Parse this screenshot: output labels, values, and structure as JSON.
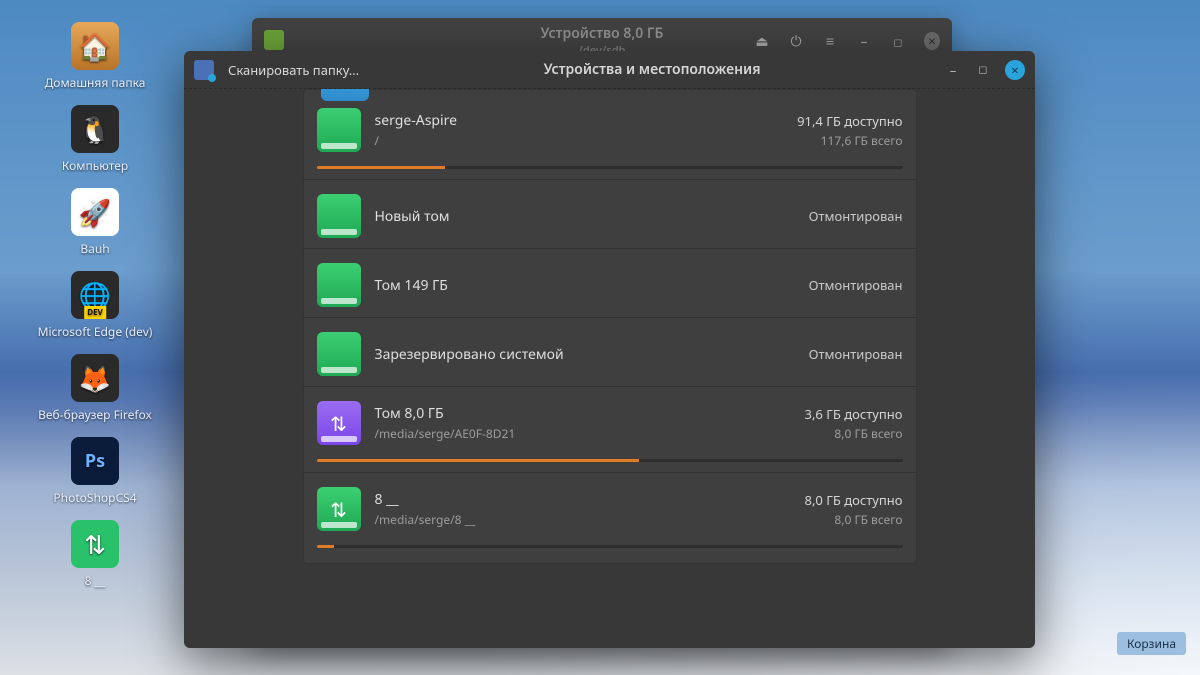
{
  "desktop": {
    "icons": [
      {
        "label": "Домашняя папка",
        "glyph": "house"
      },
      {
        "label": "Компьютер",
        "glyph": "tux"
      },
      {
        "label": "Bauh",
        "glyph": "rocket"
      },
      {
        "label": "Microsoft Edge (dev)",
        "glyph": "edge",
        "badge": true
      },
      {
        "label": "Веб-браузер Firefox",
        "glyph": "ff"
      },
      {
        "label": "PhotoShopCS4",
        "glyph": "ps"
      },
      {
        "label": "8 __",
        "glyph": "usb"
      }
    ],
    "trash": "Корзина"
  },
  "back_window": {
    "title": "Устройство 8,0 ГБ",
    "subtitle": "/dev/sdb"
  },
  "window": {
    "scan_label": "Сканировать папку…",
    "title": "Устройства и местоположения"
  },
  "volumes": [
    {
      "name": "serge-Aspire",
      "path": "/",
      "avail": "91,4 ГБ доступно",
      "total": "117,6 ГБ всего",
      "icon": "green",
      "usb": false,
      "progress": 22,
      "mounted": true
    },
    {
      "name": "Новый том",
      "state": "Отмонтирован",
      "icon": "green",
      "usb": false,
      "mounted": false
    },
    {
      "name": "Том 149 ГБ",
      "state": "Отмонтирован",
      "icon": "green",
      "usb": false,
      "mounted": false
    },
    {
      "name": "Зарезервировано системой",
      "state": "Отмонтирован",
      "icon": "green",
      "usb": false,
      "mounted": false
    },
    {
      "name": "Том 8,0 ГБ",
      "path": "/media/serge/AE0F-8D21",
      "avail": "3,6 ГБ доступно",
      "total": "8,0 ГБ всего",
      "icon": "purple",
      "usb": true,
      "progress": 55,
      "mounted": true
    },
    {
      "name": "8 __",
      "path": "/media/serge/8 __",
      "avail": "8,0 ГБ доступно",
      "total": "8,0 ГБ всего",
      "icon": "green",
      "usb": true,
      "progress": 3,
      "mounted": true
    }
  ]
}
